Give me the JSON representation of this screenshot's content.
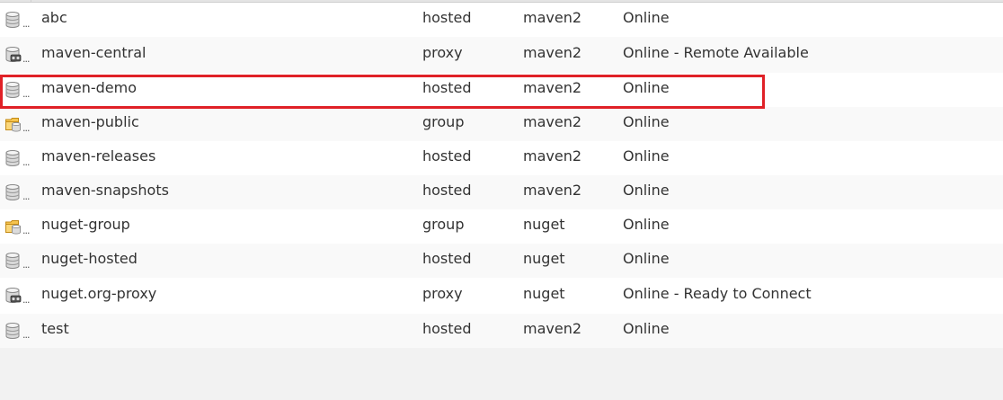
{
  "repositories": [
    {
      "name": "abc",
      "type": "hosted",
      "format": "maven2",
      "status": "Online",
      "icon": "database-icon"
    },
    {
      "name": "maven-central",
      "type": "proxy",
      "format": "maven2",
      "status": "Online - Remote Available",
      "icon": "proxy-repository-icon"
    },
    {
      "name": "maven-demo",
      "type": "hosted",
      "format": "maven2",
      "status": "Online",
      "icon": "database-icon"
    },
    {
      "name": "maven-public",
      "type": "group",
      "format": "maven2",
      "status": "Online",
      "icon": "folder-database-icon"
    },
    {
      "name": "maven-releases",
      "type": "hosted",
      "format": "maven2",
      "status": "Online",
      "icon": "database-icon"
    },
    {
      "name": "maven-snapshots",
      "type": "hosted",
      "format": "maven2",
      "status": "Online",
      "icon": "database-icon"
    },
    {
      "name": "nuget-group",
      "type": "group",
      "format": "nuget",
      "status": "Online",
      "icon": "folder-database-icon"
    },
    {
      "name": "nuget-hosted",
      "type": "hosted",
      "format": "nuget",
      "status": "Online",
      "icon": "database-icon"
    },
    {
      "name": "nuget.org-proxy",
      "type": "proxy",
      "format": "nuget",
      "status": "Online - Ready to Connect",
      "icon": "proxy-repository-icon"
    },
    {
      "name": "test",
      "type": "hosted",
      "format": "maven2",
      "status": "Online",
      "icon": "database-icon"
    }
  ],
  "icon_column_truncation": "...",
  "colors": {
    "highlight": "#e02127",
    "row_odd": "#ffffff",
    "row_even": "#f9f9f9",
    "background": "#f2f2f2"
  }
}
